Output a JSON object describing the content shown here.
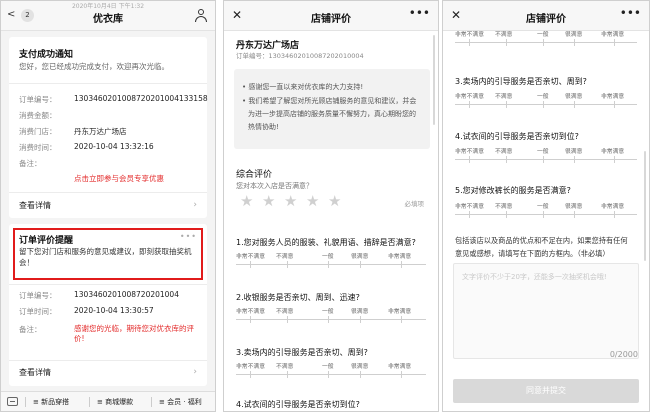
{
  "panel1": {
    "nav": {
      "back": "<",
      "badge": "2",
      "title": "优衣库",
      "subtitle": "2020年10月4日 下午1:32"
    },
    "payment_card": {
      "title": "支付成功通知",
      "desc": "您好，您已经成功完成支付，欢迎再次光临。",
      "rows": [
        {
          "k": "订单编号：",
          "v": "13034602010087202010041331​58"
        },
        {
          "k": "消费金额：",
          "v": ""
        },
        {
          "k": "消费门店：",
          "v": "丹东万达广场店"
        },
        {
          "k": "消费时间：",
          "v": "2020-10-04 13:32:16"
        },
        {
          "k": "备注：",
          "v": ""
        }
      ],
      "promo": "点击立即参与会员专享优惠",
      "details": "查看详情"
    },
    "review_card": {
      "title": "订单评价提醒",
      "desc": "留下您对门店和服务的意见或建议，即刻获取抽奖机会！",
      "dots": "•••",
      "rows": [
        {
          "k": "订单编号：",
          "v": "1303460201008720201004"
        },
        {
          "k": "订单时间：",
          "v": "2020-10-04 13:30:57"
        },
        {
          "k": "备注：",
          "v": "感谢您的光临，期待您对优衣库的评价!"
        }
      ],
      "details": "查看详情"
    },
    "tabbar": {
      "tabs": [
        "新品穿搭",
        "商城爆款",
        "会员 · 福利"
      ]
    }
  },
  "panel2": {
    "nav": {
      "close": "✕",
      "title": "店铺评价",
      "more": "•••"
    },
    "store": "丹东万达广场店",
    "order_no": "订单编号：13034602010087202010004",
    "notice": {
      "line1": "感谢您一直以来对优衣库的大力支持!",
      "line2": "我们希望了解您对所光顾店铺服务的意见和建议，并会",
      "line3": "为进一步提高店铺的服务质量不懈努力，真心期盼您的",
      "line4": "热情协助!"
    },
    "overall": {
      "title": "综合评价",
      "subtitle": "您对本次入店是否满意？",
      "required": "必填项"
    },
    "scale_labels": [
      "非常不满意",
      "不满意",
      "一般",
      "很满意",
      "非常满意"
    ],
    "questions": [
      "1.您对服务人员的服装、礼貌用语、措辞是否满意?",
      "2.收银服务是否亲切、周到、迅速?",
      "3.卖场内的引导服务是否亲切、周到?",
      "4.试衣间的引导服务是否亲切到位?"
    ]
  },
  "panel3": {
    "nav": {
      "close": "✕",
      "title": "店铺评价",
      "more": "•••"
    },
    "scale_labels": [
      "非常不满意",
      "不满意",
      "一般",
      "很满意",
      "非常满意"
    ],
    "questions": [
      "3.卖场内的引导服务是否亲切、周到?",
      "4.试衣间的引导服务是否亲切到位?",
      "5.您对修改裤长的服务是否满意?"
    ],
    "feedback_line1": "包括该店以及商品的优点和不足在内，如果您持有任何",
    "feedback_line2": "意见或感想，请填写在下面的方框内。（非必填）",
    "textarea_placeholder": "文字评价不少于20字，还能多一次抽奖机会哦!",
    "counter": "0/2000",
    "submit": "同意并提交"
  }
}
